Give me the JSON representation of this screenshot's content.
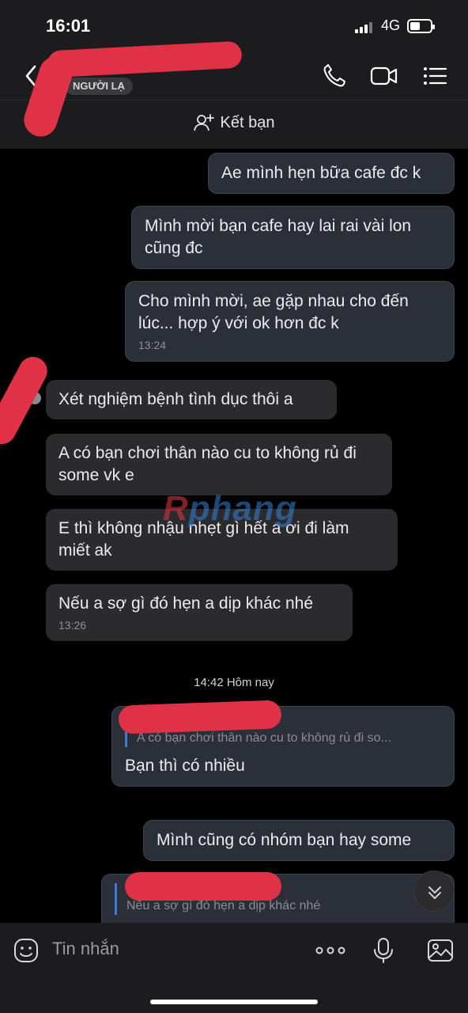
{
  "status_bar": {
    "time": "16:01",
    "network": "4G"
  },
  "header": {
    "badge": "NGƯỜI LẠ"
  },
  "add_friend": {
    "label": "Kết bạn"
  },
  "messages": [
    {
      "text": "Ae mình hẹn bữa cafe đc k"
    },
    {
      "text": "Mình mời bạn cafe hay lai rai vài lon cũng đc"
    },
    {
      "text": "Cho mình mời, ae gặp nhau cho đến lúc... hợp ý với ok hơn đc k",
      "time": "13:24"
    },
    {
      "text": "Xét nghiệm bệnh tình dục thôi a"
    },
    {
      "text": "A có bạn chơi thân nào cu to không rủ đi some vk e"
    },
    {
      "text": "E thì không nhậu nhẹt gì hết a ơi đi làm miết ak"
    },
    {
      "text": "Nếu a sợ gì đó hẹn a dịp khác nhé",
      "time": "13:26"
    },
    {
      "quote": "A có bạn chơi thân nào cu to không rủ đi so...",
      "text": "Bạn thì có nhiều"
    },
    {
      "text": "Mình cũng có nhóm bạn hay some"
    },
    {
      "quote": "Nếu a sợ gì đó hẹn a dịp khác nhé"
    }
  ],
  "date_separator": "14:42 Hôm nay",
  "watermark": {
    "part1": "R",
    "part2": "phang"
  },
  "composer": {
    "placeholder": "Tin nhắn"
  },
  "colors": {
    "outgoing_bubble": "#2a2f38",
    "incoming_bubble": "#2b2b2d",
    "quote_bar": "#3f7bd6",
    "redaction": "#e03246"
  },
  "icons": [
    "back-icon",
    "phone-icon",
    "video-call-icon",
    "menu-list-icon",
    "add-friend-icon",
    "chevron-down-icon",
    "sticker-icon",
    "more-dots-icon",
    "microphone-icon",
    "image-icon"
  ]
}
